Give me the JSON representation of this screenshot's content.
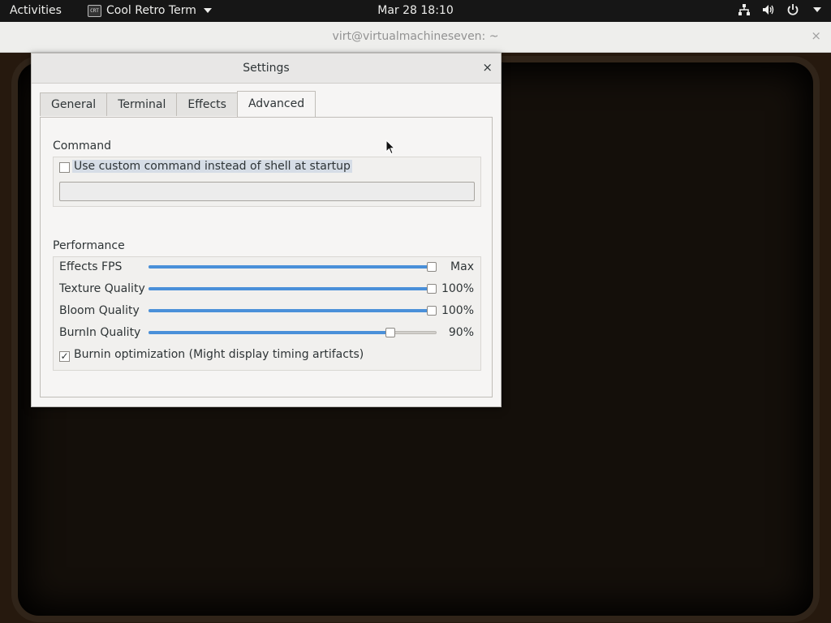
{
  "topbar": {
    "activities": "Activities",
    "app_name": "Cool Retro Term",
    "app_icon_text": "CRT",
    "clock": "Mar 28  18:10",
    "status_icons": [
      "network-icon",
      "volume-icon",
      "power-icon",
      "chevron-down-icon"
    ]
  },
  "terminal": {
    "title": "virt@virtualmachineseven: ~",
    "close_glyph": "×"
  },
  "dialog": {
    "title": "Settings",
    "close_glyph": "×",
    "tabs": [
      {
        "label": "General",
        "active": false
      },
      {
        "label": "Terminal",
        "active": false
      },
      {
        "label": "Effects",
        "active": false
      },
      {
        "label": "Advanced",
        "active": true
      }
    ],
    "command": {
      "group_label": "Command",
      "custom_command_label": "Use custom command instead of shell at startup",
      "custom_command_checked": false,
      "command_value": ""
    },
    "performance": {
      "group_label": "Performance",
      "sliders": [
        {
          "label": "Effects FPS",
          "value_text": "Max",
          "fraction": 1.0
        },
        {
          "label": "Texture Quality",
          "value_text": "100%",
          "fraction": 1.0
        },
        {
          "label": "Bloom Quality",
          "value_text": "100%",
          "fraction": 1.0
        },
        {
          "label": "BurnIn Quality",
          "value_text": "90%",
          "fraction": 0.85
        }
      ],
      "burnin_optimization_label": "Burnin optimization (Might display timing artifacts)",
      "burnin_optimization_checked": true,
      "check_glyph": "✓"
    }
  },
  "colors": {
    "accent": "#4a90d9",
    "topbar_bg": "#161616",
    "dialog_bg": "#f6f5f4"
  }
}
